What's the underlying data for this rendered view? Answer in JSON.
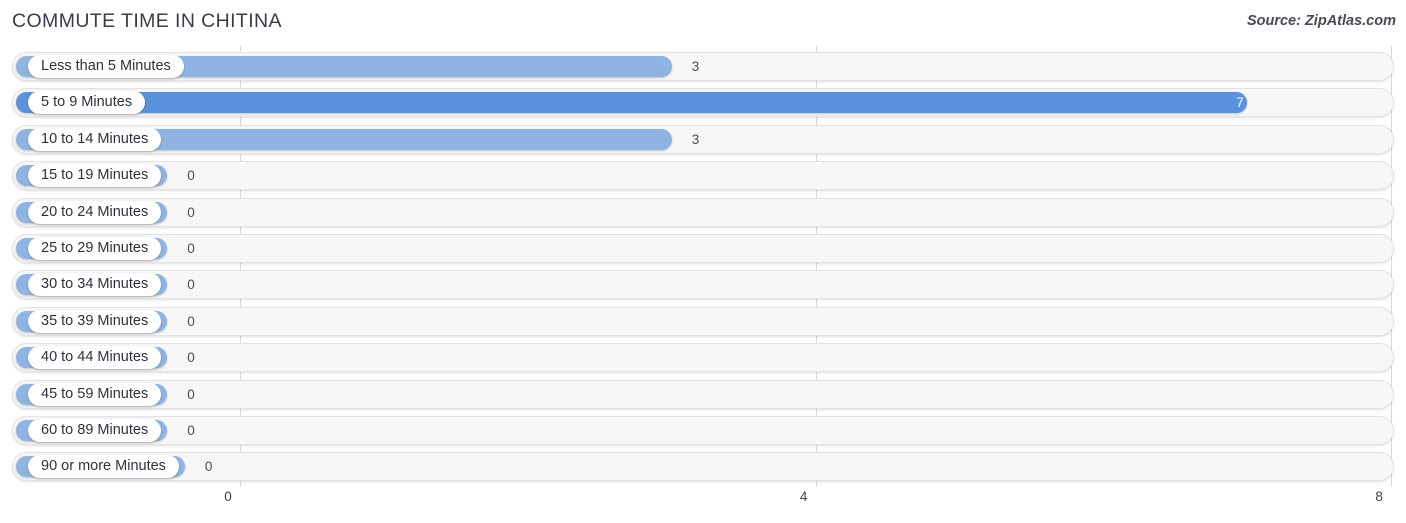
{
  "header": {
    "title": "COMMUTE TIME IN CHITINA",
    "source": "Source: ZipAtlas.com"
  },
  "colors": {
    "bar_light": "#8fb4e3",
    "bar_dark": "#5b92dd",
    "track_fill": "#f7f7f8",
    "track_border": "#e3e3e6",
    "gridline": "#d8d8dc",
    "text": "#3c3c49",
    "value_inside": "#ffffff"
  },
  "chart_data": {
    "type": "bar",
    "orientation": "horizontal",
    "title": "COMMUTE TIME IN CHITINA",
    "xlabel": "",
    "ylabel": "",
    "xlim": [
      0,
      8
    ],
    "grid": true,
    "legend": "none",
    "xticks": [
      "0",
      "4",
      "8"
    ],
    "xtick_values": [
      0,
      4,
      8
    ],
    "categories": [
      "Less than 5 Minutes",
      "5 to 9 Minutes",
      "10 to 14 Minutes",
      "15 to 19 Minutes",
      "20 to 24 Minutes",
      "25 to 29 Minutes",
      "30 to 34 Minutes",
      "35 to 39 Minutes",
      "40 to 44 Minutes",
      "45 to 59 Minutes",
      "60 to 89 Minutes",
      "90 or more Minutes"
    ],
    "values": [
      3,
      7,
      3,
      0,
      0,
      0,
      0,
      0,
      0,
      0,
      0,
      0
    ],
    "value_labels": [
      "3",
      "7",
      "3",
      "0",
      "0",
      "0",
      "0",
      "0",
      "0",
      "0",
      "0",
      "0"
    ]
  },
  "rows": [
    {
      "label": "Less than 5 Minutes",
      "value": 3,
      "value_label": "3",
      "highlight": false
    },
    {
      "label": "5 to 9 Minutes",
      "value": 7,
      "value_label": "7",
      "highlight": true
    },
    {
      "label": "10 to 14 Minutes",
      "value": 3,
      "value_label": "3",
      "highlight": false
    },
    {
      "label": "15 to 19 Minutes",
      "value": 0,
      "value_label": "0",
      "highlight": false
    },
    {
      "label": "20 to 24 Minutes",
      "value": 0,
      "value_label": "0",
      "highlight": false
    },
    {
      "label": "25 to 29 Minutes",
      "value": 0,
      "value_label": "0",
      "highlight": false
    },
    {
      "label": "30 to 34 Minutes",
      "value": 0,
      "value_label": "0",
      "highlight": false
    },
    {
      "label": "35 to 39 Minutes",
      "value": 0,
      "value_label": "0",
      "highlight": false
    },
    {
      "label": "40 to 44 Minutes",
      "value": 0,
      "value_label": "0",
      "highlight": false
    },
    {
      "label": "45 to 59 Minutes",
      "value": 0,
      "value_label": "0",
      "highlight": false
    },
    {
      "label": "60 to 89 Minutes",
      "value": 0,
      "value_label": "0",
      "highlight": false
    },
    {
      "label": "90 or more Minutes",
      "value": 0,
      "value_label": "0",
      "highlight": false
    }
  ],
  "axis": {
    "ticks": [
      {
        "label": "0",
        "value": 0
      },
      {
        "label": "4",
        "value": 4
      },
      {
        "label": "8",
        "value": 8
      }
    ]
  }
}
